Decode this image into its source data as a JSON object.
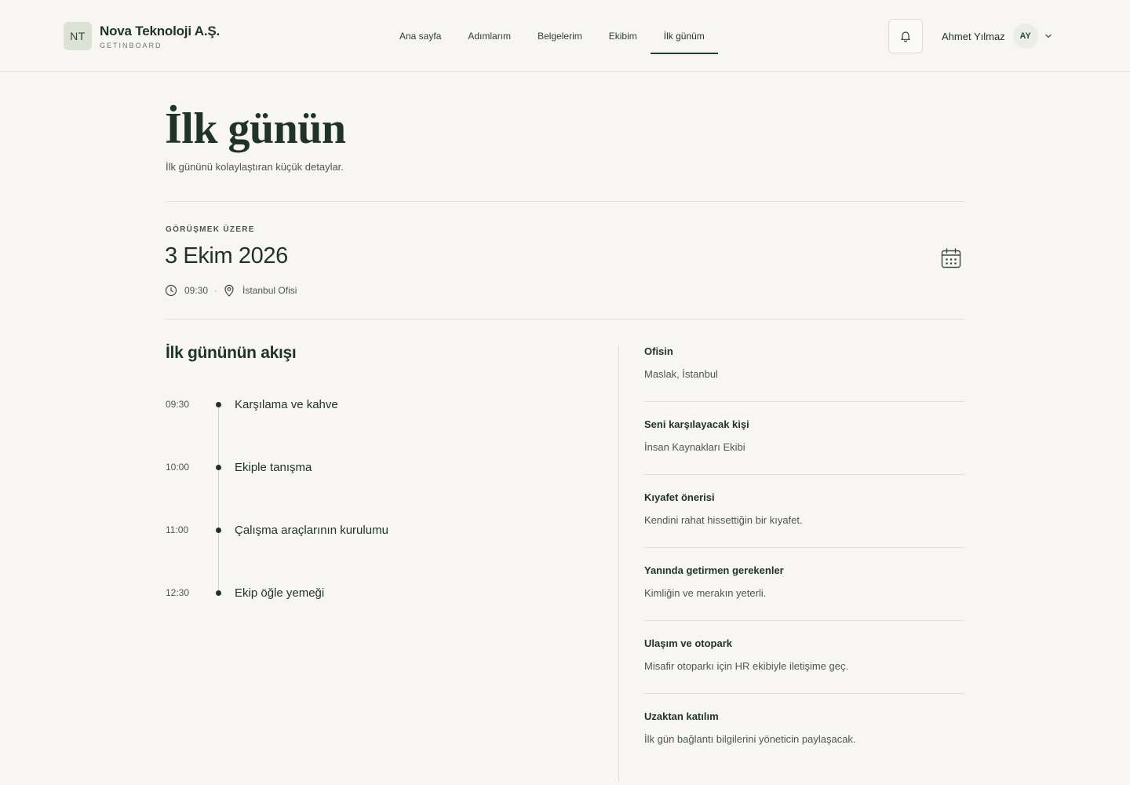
{
  "brand": {
    "initials": "NT",
    "name": "Nova Teknoloji A.Ş.",
    "product": "GETINBOARD"
  },
  "nav": {
    "items": [
      {
        "label": "Ana sayfa"
      },
      {
        "label": "Adımlarım"
      },
      {
        "label": "Belgelerim"
      },
      {
        "label": "Ekibim"
      },
      {
        "label": "İlk günüm",
        "active": true
      }
    ]
  },
  "user": {
    "name": "Ahmet Yılmaz",
    "initials": "AY"
  },
  "icons": {
    "bell": "bell-icon",
    "chevron": "chevron-down-icon",
    "calendar": "calendar-icon",
    "clock": "clock-icon",
    "pin": "location-pin-icon"
  },
  "colors": {
    "background": "#f7f6f2",
    "primary": "#1f3328",
    "muted": "#4d5751",
    "border": "#e2e0da"
  },
  "page": {
    "title": "İlk günün",
    "subtitle": "İlk gününü kolaylaştıran küçük detaylar."
  },
  "event": {
    "eyebrow": "GÖRÜŞMEK ÜZERE",
    "date": "3 Ekim 2026",
    "time": "09:30",
    "separator": "·",
    "location": "İstanbul Ofisi"
  },
  "schedule": {
    "title": "İlk gününün akışı",
    "items": [
      {
        "time": "09:30",
        "label": "Karşılama ve kahve"
      },
      {
        "time": "10:00",
        "label": "Ekiple tanışma"
      },
      {
        "time": "11:00",
        "label": "Çalışma araçlarının kurulumu"
      },
      {
        "time": "12:30",
        "label": "Ekip öğle yemeği"
      }
    ]
  },
  "info": {
    "items": [
      {
        "title": "Ofisin",
        "text": "Maslak, İstanbul"
      },
      {
        "title": "Seni karşılayacak kişi",
        "text": "İnsan Kaynakları Ekibi"
      },
      {
        "title": "Kıyafet önerisi",
        "text": "Kendini rahat hissettiğin bir kıyafet."
      },
      {
        "title": "Yanında getirmen gerekenler",
        "text": "Kimliğin ve merakın yeterli."
      },
      {
        "title": "Ulaşım ve otopark",
        "text": "Misafir otoparkı için HR ekibiyle iletişime geç."
      },
      {
        "title": "Uzaktan katılım",
        "text": "İlk gün bağlantı bilgilerini yöneticin paylaşacak."
      }
    ]
  }
}
